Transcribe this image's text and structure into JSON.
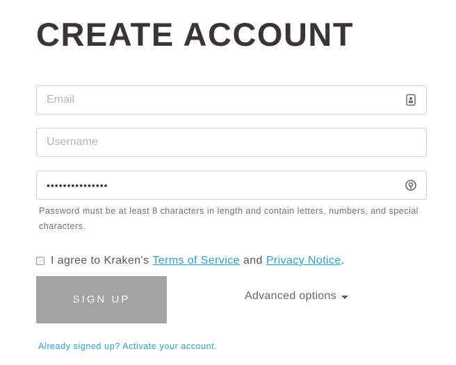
{
  "page": {
    "title": "CREATE ACCOUNT"
  },
  "form": {
    "email": {
      "placeholder": "Email",
      "value": ""
    },
    "username": {
      "placeholder": "Username",
      "value": ""
    },
    "password": {
      "value": "•••••••••••••••"
    },
    "password_hint": "Password must be at least 8 characters in length and contain letters, numbers, and special characters.",
    "agree": {
      "prefix": "I agree to Kraken's",
      "terms_link": "Terms of Service",
      "and": "and",
      "privacy_link": "Privacy Notice",
      "suffix": ".",
      "checked": false
    },
    "signup_label": "SIGN UP",
    "advanced_label": "Advanced options",
    "activate_link": "Already signed up? Activate your account."
  },
  "icons": {
    "email": "contact-card-icon",
    "password": "password-manager-key-icon",
    "advanced": "caret-down-icon"
  },
  "colors": {
    "title": "#3c3433",
    "link": "#2a9fd8",
    "button_bg": "#a3a3a3",
    "border": "#cfcfcf"
  }
}
